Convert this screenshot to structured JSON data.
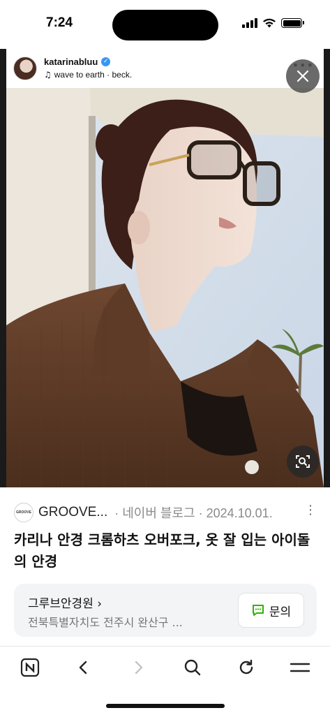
{
  "status_bar": {
    "time": "7:24"
  },
  "post": {
    "username": "katarinabluu",
    "music_text": "wave to earth · beck."
  },
  "result": {
    "source_logo_text": "GROOVE",
    "source_name": "GROOVE...",
    "source_meta": "· 네이버 블로그 · 2024.10.01.",
    "title": "카리나 안경 크롬하츠 오버포크, 옷 잘 입는 아이돌의 안경",
    "place_name": "그루브안경원 ›",
    "place_address": "전북특별자치도 전주시 완산구 ...",
    "inquiry_label": "문의"
  },
  "icons": {
    "verified": "verified-badge-icon",
    "music": "music-note-icon",
    "close": "close-icon",
    "lens": "visual-search-icon",
    "more": "more-vertical-icon",
    "toolbar": [
      "naver-home-icon",
      "back-icon",
      "forward-icon",
      "search-icon",
      "refresh-icon",
      "menu-icon"
    ]
  },
  "colors": {
    "verified": "#3897f0",
    "inquiry_icon": "#2db400",
    "disabled": "#c4c4c4"
  }
}
